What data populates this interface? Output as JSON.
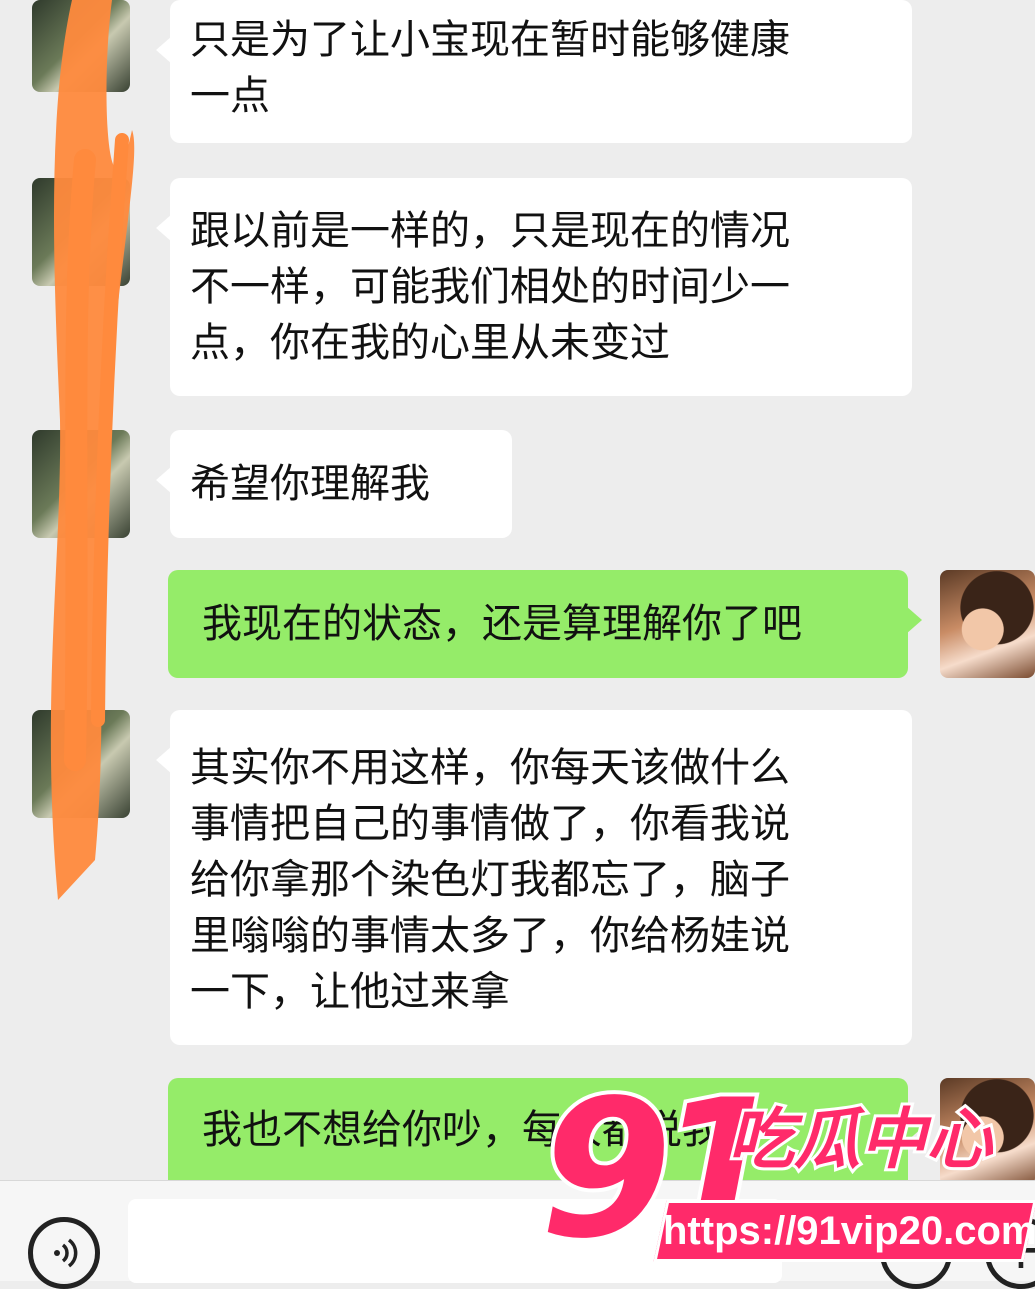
{
  "chat": {
    "messages": [
      {
        "side": "in",
        "text": "只是为了让小宝现在暂时能够健康\n一点"
      },
      {
        "side": "in",
        "text": "跟以前是一样的，只是现在的情况\n不一样，可能我们相处的时间少一\n点，你在我的心里从未变过"
      },
      {
        "side": "in",
        "text": "希望你理解我"
      },
      {
        "side": "out",
        "text": "我现在的状态，还是算理解你了吧"
      },
      {
        "side": "in",
        "text": "其实你不用这样，你每天该做什么\n事情把自己的事情做了，你看我说\n给你拿那个染色灯我都忘了，脑子\n里嗡嗡的事情太多了，你给杨娃说\n一下，让他过来拿"
      },
      {
        "side": "out",
        "text": "我也不想给你吵，每次都说我"
      }
    ]
  },
  "input_bar": {
    "voice_icon": "voice-icon",
    "emoji_icon": "emoji-icon",
    "plus_icon": "plus-icon",
    "plus_glyph": "+"
  },
  "watermark": {
    "number": "91",
    "name": "吃瓜中心",
    "url": "https://91vip20.com",
    "color": "#ff2a6a"
  },
  "colors": {
    "background": "#ededed",
    "incoming_bubble": "#ffffff",
    "outgoing_bubble": "#95ec69",
    "redaction": "#ff8a3d"
  }
}
